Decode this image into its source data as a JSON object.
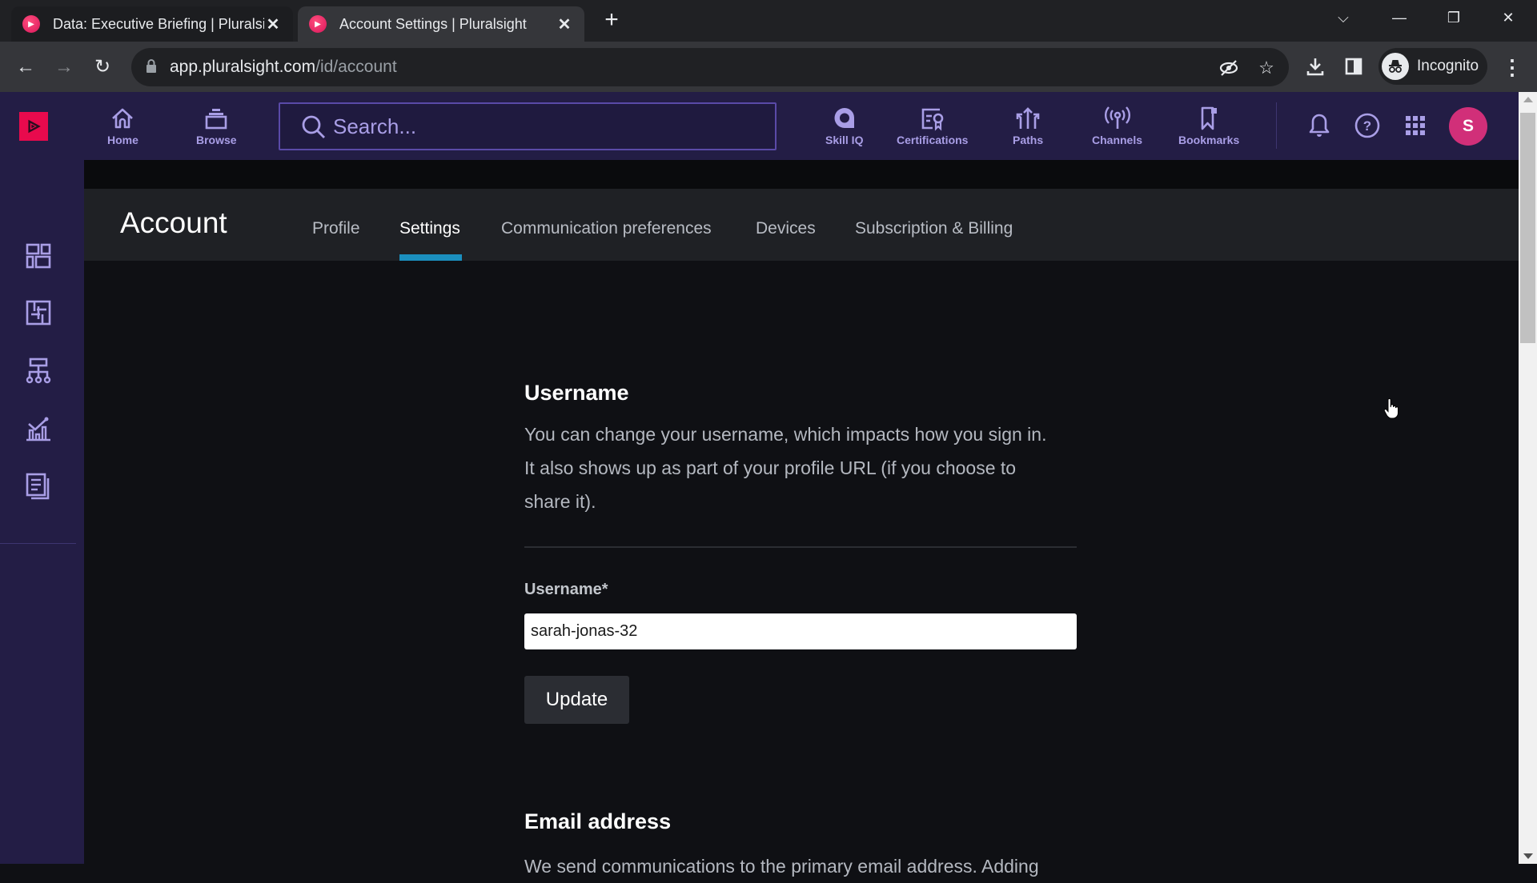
{
  "browser": {
    "tabs": [
      {
        "title": "Data: Executive Briefing | Pluralsight",
        "active": false
      },
      {
        "title": "Account Settings | Pluralsight",
        "active": true
      }
    ],
    "new_tab_label": "+",
    "address": {
      "host": "app.pluralsight.com",
      "path": "/id/account"
    },
    "profile_label": "Incognito"
  },
  "header": {
    "nav": [
      {
        "label": "Home",
        "icon": "home-icon"
      },
      {
        "label": "Browse",
        "icon": "browse-icon"
      },
      {
        "label": "Skill IQ",
        "icon": "skill-iq-icon"
      },
      {
        "label": "Certifications",
        "icon": "certifications-icon"
      },
      {
        "label": "Paths",
        "icon": "paths-icon"
      },
      {
        "label": "Channels",
        "icon": "channels-icon"
      },
      {
        "label": "Bookmarks",
        "icon": "bookmarks-icon"
      }
    ],
    "search_placeholder": "Search...",
    "user_initial": "S"
  },
  "sidebar": {
    "icons": [
      "dashboard-icon",
      "skills-board-icon",
      "org-hierarchy-icon",
      "analytics-icon",
      "reports-icon"
    ]
  },
  "account": {
    "title": "Account",
    "tabs": [
      {
        "label": "Profile",
        "active": false
      },
      {
        "label": "Settings",
        "active": true
      },
      {
        "label": "Communication preferences",
        "active": false
      },
      {
        "label": "Devices",
        "active": false
      },
      {
        "label": "Subscription & Billing",
        "active": false
      }
    ]
  },
  "username_section": {
    "heading": "Username",
    "description": [
      "You can change your username, which impacts how you sign in.",
      "It also shows up as part of your profile URL (if you choose to",
      "share it)."
    ],
    "field_label": "Username*",
    "field_value": "sarah-jonas-32",
    "button_label": "Update"
  },
  "email_section": {
    "heading": "Email address",
    "description_partial": "We send communications to the primary email address. Adding"
  },
  "colors": {
    "brand": "#e80a4d",
    "header_bg": "#231d45",
    "nav_text": "#a99ee6",
    "active_tab_indicator": "#1b8fbe",
    "avatar": "#d12f79"
  }
}
